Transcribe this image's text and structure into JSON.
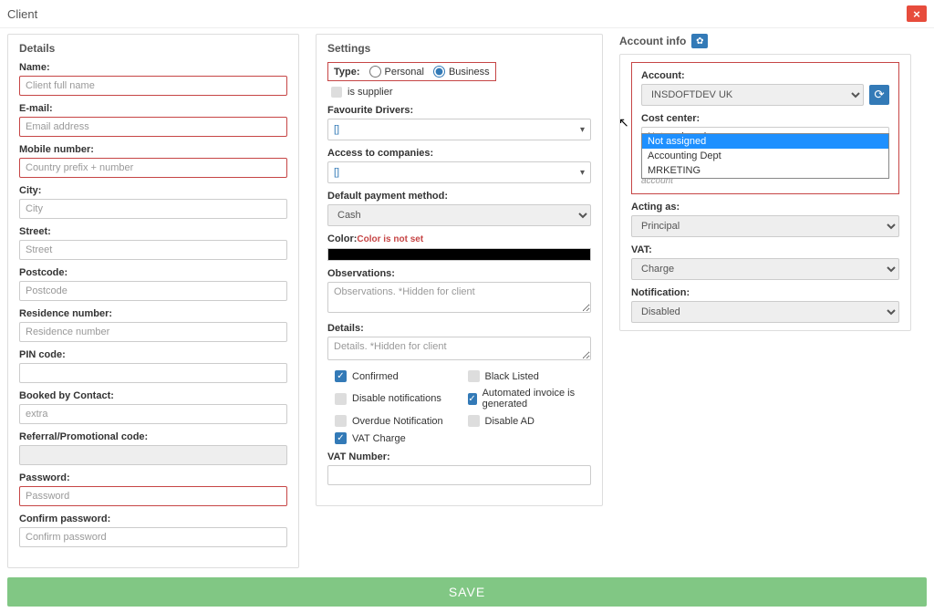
{
  "header": {
    "title": "Client",
    "close": "×"
  },
  "details": {
    "title": "Details",
    "name_label": "Name:",
    "name_ph": "Client full name",
    "email_label": "E-mail:",
    "email_ph": "Email address",
    "mobile_label": "Mobile number:",
    "mobile_ph": "Country prefix + number",
    "city_label": "City:",
    "city_ph": "City",
    "street_label": "Street:",
    "street_ph": "Street",
    "postcode_label": "Postcode:",
    "postcode_ph": "Postcode",
    "residence_label": "Residence number:",
    "residence_ph": "Residence number",
    "pin_label": "PIN code:",
    "booked_label": "Booked by Contact:",
    "booked_ph": "extra",
    "referral_label": "Referral/Promotional code:",
    "password_label": "Password:",
    "password_ph": "Password",
    "confirm_label": "Confirm password:",
    "confirm_ph": "Confirm password"
  },
  "settings": {
    "title": "Settings",
    "type_label": "Type:",
    "personal": "Personal",
    "business": "Business",
    "is_supplier": "is supplier",
    "fav_label": "Favourite Drivers:",
    "fav_bracket": "[]",
    "access_label": "Access to companies:",
    "access_bracket": "[]",
    "paymethod_label": "Default payment method:",
    "paymethod_value": "Cash",
    "color_label": "Color:",
    "color_hint": "Color is not set",
    "obs_label": "Observations:",
    "obs_ph": "Observations. *Hidden for client",
    "det_label": "Details:",
    "det_ph": "Details. *Hidden for client",
    "chk_confirmed": "Confirmed",
    "chk_blacklist": "Black Listed",
    "chk_disable_notif": "Disable notifications",
    "chk_auto_invoice": "Automated invoice is generated",
    "chk_overdue": "Overdue Notification",
    "chk_disable_ad": "Disable AD",
    "chk_vat": "VAT Charge",
    "vat_label": "VAT Number:"
  },
  "account": {
    "title": "Account info",
    "account_label": "Account:",
    "account_value": "INSDOFTDEV UK",
    "cost_label": "Cost center:",
    "cost_value": "Not assigned",
    "cost_options": [
      "Not assigned",
      "Accounting Dept",
      "MRKETING"
    ],
    "note": "account",
    "acting_label": "Acting as:",
    "acting_value": "Principal",
    "vat_label": "VAT:",
    "vat_value": "Charge",
    "notif_label": "Notification:",
    "notif_value": "Disabled"
  },
  "save": "SAVE"
}
